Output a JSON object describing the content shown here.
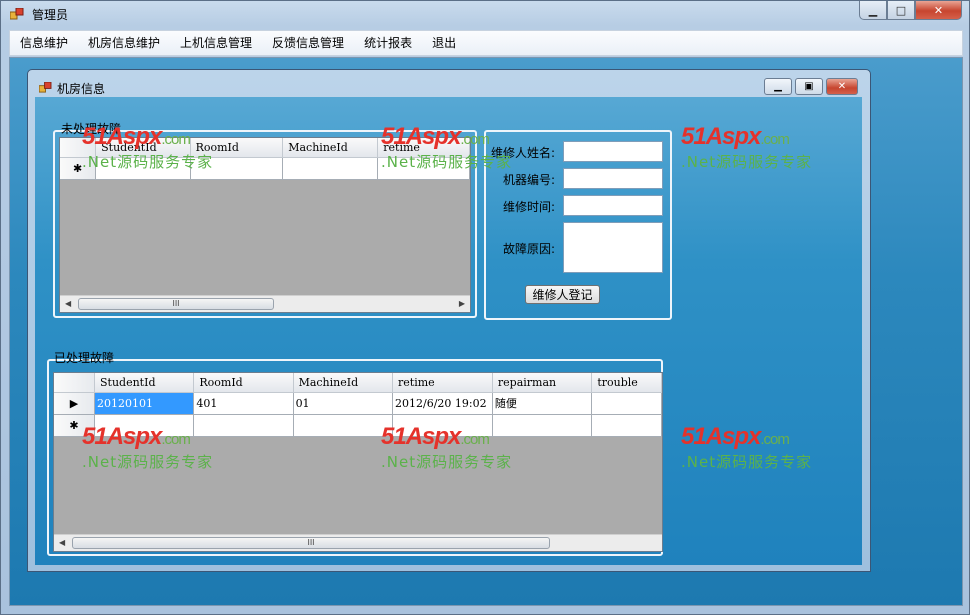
{
  "window": {
    "title": "管理员"
  },
  "menu": [
    "信息维护",
    "机房信息维护",
    "上机信息管理",
    "反馈信息管理",
    "统计报表",
    "退出"
  ],
  "child": {
    "title": "机房信息"
  },
  "unprocessed": {
    "group_label": "未处理故障",
    "columns": [
      "StudentId",
      "RoomId",
      "MachineId",
      "retime"
    ],
    "new_row_marker": "✱"
  },
  "form": {
    "repairman_label": "维修人姓名:",
    "machine_label": "机器编号:",
    "time_label": "维修时间:",
    "reason_label": "故障原因:",
    "repairman_value": "",
    "machine_value": "",
    "time_value": "",
    "reason_value": "",
    "submit_label": "维修人登记"
  },
  "processed": {
    "group_label": "已处理故障",
    "columns": [
      "StudentId",
      "RoomId",
      "MachineId",
      "retime",
      "repairman",
      "trouble"
    ],
    "rows": [
      {
        "marker": "▶",
        "cells": [
          "20120101",
          "401",
          "01",
          "2012/6/20 19:02",
          "随便",
          ""
        ]
      }
    ],
    "new_row_marker": "✱"
  },
  "scroll_thumb_glyph": "III",
  "watermark": {
    "logo": "51Aspx",
    "domain": ".com",
    "slogan": ".Net源码服务专家"
  }
}
